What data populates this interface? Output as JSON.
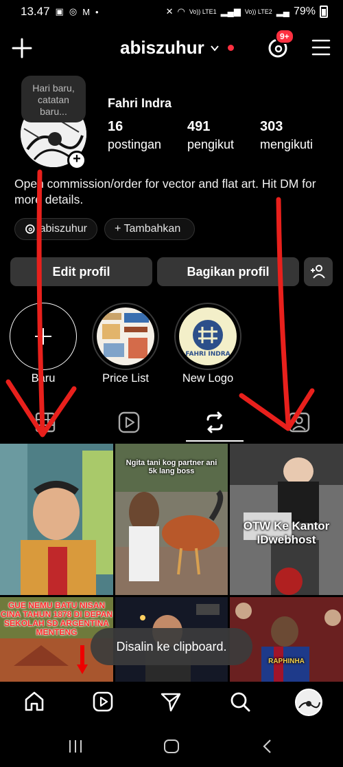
{
  "status_bar": {
    "time": "13.47",
    "network_labels": [
      "Vo)) LTE1",
      "Vo)) LTE2"
    ],
    "battery": "79%"
  },
  "header": {
    "username": "abiszuhur",
    "notification_badge": "9+"
  },
  "profile": {
    "note": "Hari baru, catatan baru...",
    "display_name": "Fahri Indra",
    "stats": [
      {
        "value": "16",
        "label": "postingan"
      },
      {
        "value": "491",
        "label": "pengikut"
      },
      {
        "value": "303",
        "label": "mengikuti"
      }
    ],
    "bio": "Open commission/order for vector and flat art. Hit DM for more details."
  },
  "chips": {
    "threads_handle": "abiszuhur",
    "add_label": "+ Tambahkan"
  },
  "actions": {
    "edit_profile": "Edit profil",
    "share_profile": "Bagikan profil"
  },
  "highlights": [
    {
      "label": "Baru"
    },
    {
      "label": "Price List"
    },
    {
      "label": "New Logo"
    }
  ],
  "highlight_logo_text": "FAHRI INDRA",
  "grid_posts": [
    {
      "caption": ""
    },
    {
      "caption": "Ngita tani kog partner ani 5k lang boss"
    },
    {
      "caption": "OTW Ke Kantor IDwebhost"
    },
    {
      "caption": "GUE NEMU BATU NISAN CINA TAHUN 1878 DI DEPAN SEKOLAH SD ARGENTINA MENTENG"
    },
    {
      "caption": ""
    },
    {
      "caption": "RAPHINHA"
    }
  ],
  "toast": "Disalin ke clipboard.",
  "colors": {
    "background": "#000000",
    "button_bg": "#363636",
    "accent_red": "#ff3040",
    "overlay_arrow": "#e8201c"
  },
  "icons": {
    "top_left": "plus-icon",
    "top_right": [
      "threads-icon",
      "menu-icon"
    ],
    "tabs": [
      "grid-icon",
      "reels-icon",
      "reposts-icon",
      "tagged-icon"
    ],
    "bottom_nav": [
      "home-icon",
      "reels-icon",
      "send-icon",
      "search-icon",
      "profile-avatar"
    ]
  }
}
